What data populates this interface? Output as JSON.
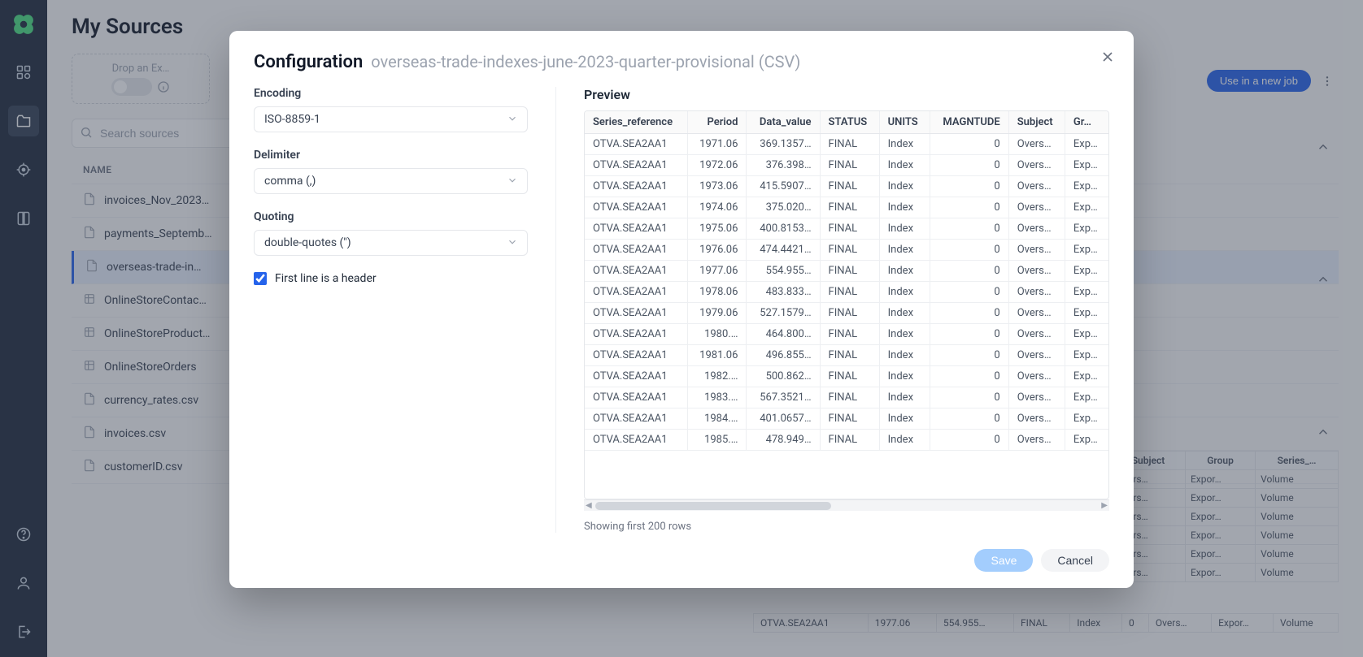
{
  "page": {
    "title": "My Sources",
    "drop_hint": "Drop an Ex…",
    "use_new_job": "Use in a new job",
    "search_placeholder": "Search sources",
    "list_header": "NAME"
  },
  "sources": [
    {
      "name": "invoices_Nov_2023…",
      "icon": "file"
    },
    {
      "name": "payments_Septemb…",
      "icon": "file"
    },
    {
      "name": "overseas-trade-in…",
      "icon": "file",
      "current": true
    },
    {
      "name": "OnlineStoreContac…",
      "icon": "db"
    },
    {
      "name": "OnlineStoreProduct…",
      "icon": "db"
    },
    {
      "name": "OnlineStoreOrders",
      "icon": "db"
    },
    {
      "name": "currency_rates.csv",
      "icon": "file"
    },
    {
      "name": "invoices.csv",
      "icon": "file"
    },
    {
      "name": "customerID.csv",
      "icon": "file"
    }
  ],
  "dialog": {
    "title": "Configuration",
    "subtitle": "overseas-trade-indexes-june-2023-quarter-provisional (CSV)",
    "encoding_label": "Encoding",
    "encoding_value": "ISO-8859-1",
    "delimiter_label": "Delimiter",
    "delimiter_value": "comma (,)",
    "quoting_label": "Quoting",
    "quoting_value": "double-quotes (\")",
    "header_checkbox": "First line is a header",
    "preview_label": "Preview",
    "showing": "Showing first 200 rows",
    "save": "Save",
    "cancel": "Cancel",
    "columns": [
      "Series_reference",
      "Period",
      "Data_value",
      "STATUS",
      "UNITS",
      "MAGNTUDE",
      "Subject",
      "Gr…"
    ],
    "rows": [
      [
        "OTVA.SEA2AA1",
        "1971.06",
        "369.1357…",
        "FINAL",
        "Index",
        "0",
        "Overs…",
        "Exp…"
      ],
      [
        "OTVA.SEA2AA1",
        "1972.06",
        "376.398…",
        "FINAL",
        "Index",
        "0",
        "Overs…",
        "Exp…"
      ],
      [
        "OTVA.SEA2AA1",
        "1973.06",
        "415.5907…",
        "FINAL",
        "Index",
        "0",
        "Overs…",
        "Exp…"
      ],
      [
        "OTVA.SEA2AA1",
        "1974.06",
        "375.020…",
        "FINAL",
        "Index",
        "0",
        "Overs…",
        "Exp…"
      ],
      [
        "OTVA.SEA2AA1",
        "1975.06",
        "400.8153…",
        "FINAL",
        "Index",
        "0",
        "Overs…",
        "Exp…"
      ],
      [
        "OTVA.SEA2AA1",
        "1976.06",
        "474.4421…",
        "FINAL",
        "Index",
        "0",
        "Overs…",
        "Exp…"
      ],
      [
        "OTVA.SEA2AA1",
        "1977.06",
        "554.955…",
        "FINAL",
        "Index",
        "0",
        "Overs…",
        "Exp…"
      ],
      [
        "OTVA.SEA2AA1",
        "1978.06",
        "483.833…",
        "FINAL",
        "Index",
        "0",
        "Overs…",
        "Exp…"
      ],
      [
        "OTVA.SEA2AA1",
        "1979.06",
        "527.1579…",
        "FINAL",
        "Index",
        "0",
        "Overs…",
        "Exp…"
      ],
      [
        "OTVA.SEA2AA1",
        "1980.…",
        "464.800…",
        "FINAL",
        "Index",
        "0",
        "Overs…",
        "Exp…"
      ],
      [
        "OTVA.SEA2AA1",
        "1981.06",
        "496.855…",
        "FINAL",
        "Index",
        "0",
        "Overs…",
        "Exp…"
      ],
      [
        "OTVA.SEA2AA1",
        "1982.…",
        "500.862…",
        "FINAL",
        "Index",
        "0",
        "Overs…",
        "Exp…"
      ],
      [
        "OTVA.SEA2AA1",
        "1983.…",
        "567.3521…",
        "FINAL",
        "Index",
        "0",
        "Overs…",
        "Exp…"
      ],
      [
        "OTVA.SEA2AA1",
        "1984.…",
        "401.0657…",
        "FINAL",
        "Index",
        "0",
        "Overs…",
        "Exp…"
      ],
      [
        "OTVA.SEA2AA1",
        "1985.…",
        "478.949…",
        "FINAL",
        "Index",
        "0",
        "Overs…",
        "Exp…"
      ]
    ]
  },
  "bg_table": {
    "columns": [
      "Subject",
      "Group",
      "Series_…"
    ],
    "rows": [
      [
        "Overs…",
        "Expor…",
        "Volume"
      ],
      [
        "Overs…",
        "Expor…",
        "Volume"
      ],
      [
        "Overs…",
        "Expor…",
        "Volume"
      ],
      [
        "Overs…",
        "Expor…",
        "Volume"
      ],
      [
        "Overs…",
        "Expor…",
        "Volume"
      ],
      [
        "Overs…",
        "Expor…",
        "Volume"
      ]
    ]
  },
  "bg_row": [
    "OTVA.SEA2AA1",
    "1977.06",
    "554.955…",
    "FINAL",
    "Index",
    "0",
    "Overs…",
    "Expor…",
    "Volume"
  ]
}
